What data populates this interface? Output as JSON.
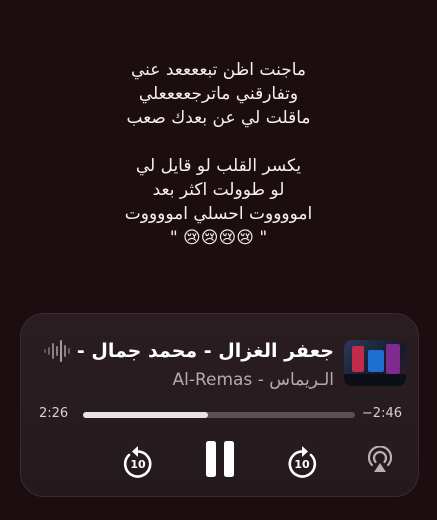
{
  "lyrics": {
    "lines": [
      "ماجنت اظن تبععععد عني",
      "وتفارقني ماترجععععلي",
      "ماقلت لي عن بعدك صعب",
      "",
      "يكسر القلب لو قايل لي",
      "لو طوولت اكثر بعد",
      "امووووت احسلي امووووت",
      "\" 😢😢😢😢 \""
    ]
  },
  "player": {
    "title": "جعفر الغزال - محمد جمال -",
    "artist": "الـريماس - Al-Remas",
    "elapsed": "2:26",
    "remaining": "−2:46",
    "progress": 0.46,
    "skip_back_seconds": "10",
    "skip_forward_seconds": "10",
    "state": "playing"
  },
  "icons": {
    "waveform": "waveform-icon",
    "skip_back": "gobackward-10-icon",
    "pause": "pause-icon",
    "skip_forward": "goforward-10-icon",
    "airplay": "airplay-icon"
  },
  "colors": {
    "background": "#1c0d10",
    "player_bg": "#2a1d21",
    "track": "#5c5055",
    "track_fill": "#e9e3e6",
    "secondary_text": "#b5aaae"
  }
}
